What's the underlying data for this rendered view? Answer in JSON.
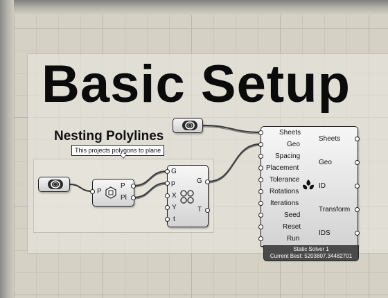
{
  "canvas": {
    "title": "Basic Setup",
    "subtitle": "Nesting Polylines",
    "tooltip": "This projects polygons to plane"
  },
  "proj_component": {
    "inputs": [
      "P"
    ],
    "outputs": [
      "P",
      "Pl"
    ],
    "icon": "project-polygon-icon"
  },
  "eval_component": {
    "inputs": [
      "G",
      "p",
      "X",
      "Y",
      "t"
    ],
    "outputs": [
      "G",
      "T"
    ],
    "icon": "polygon-cluster-icon"
  },
  "solver": {
    "inputs": [
      "Sheets",
      "Geo",
      "Spacing",
      "Placement",
      "Tolerance",
      "Rotations",
      "Iterations",
      "Seed",
      "Reset",
      "Run"
    ],
    "outputs": [
      "Sheets",
      "Geo",
      "ID",
      "Transform",
      "IDS"
    ],
    "icon": "opennest-logo-icon",
    "name": "Static Solver 1",
    "status": "Current Best: 5203807.34482701"
  },
  "colors": {
    "canvas_bg": "#d5d1c5",
    "component_fill": "#e8e8e8",
    "wire": "#3a3a3a"
  }
}
